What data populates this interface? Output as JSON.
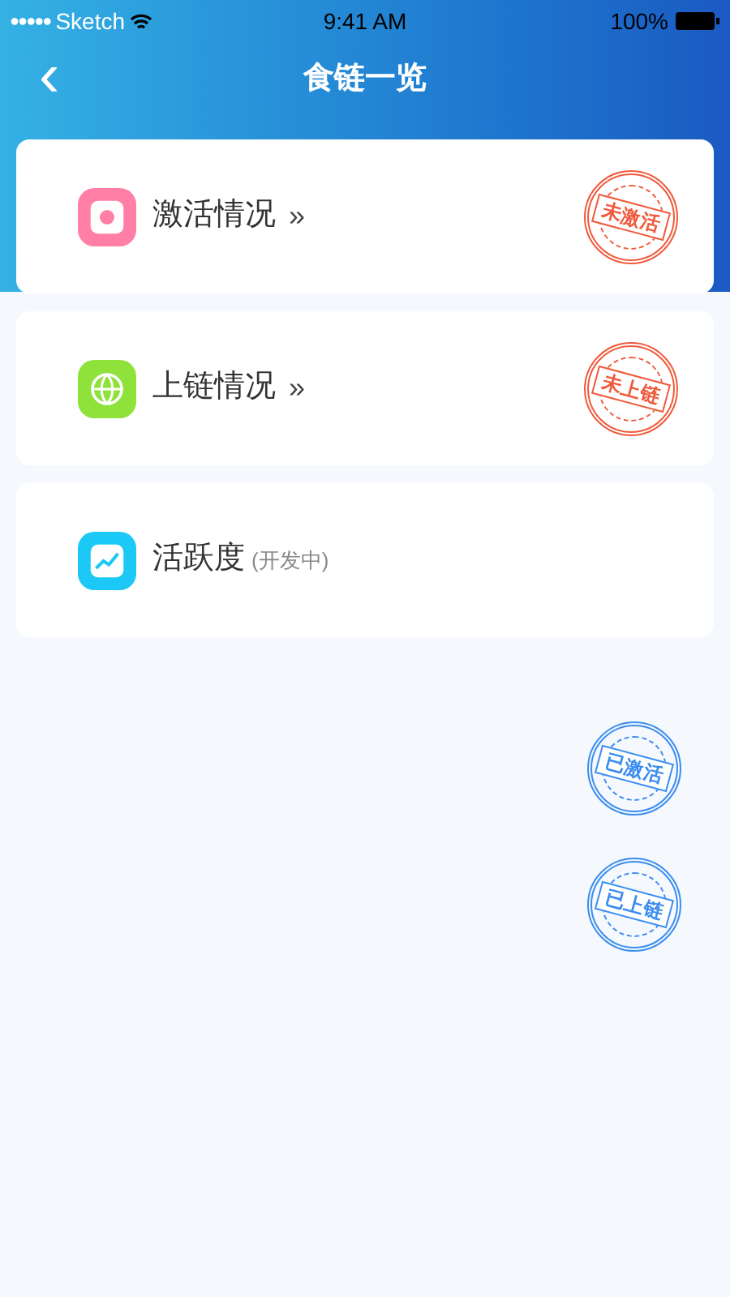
{
  "status_bar": {
    "signal": "●●●●●",
    "carrier": "Sketch",
    "time": "9:41 AM",
    "battery": "100%"
  },
  "nav": {
    "back": "‹",
    "title": "食链一览"
  },
  "cards": [
    {
      "kind": "badge",
      "color": "#ff7fa6",
      "title": "激活情况",
      "arrow": "»",
      "stamp": {
        "text": "未激活",
        "color": "#f05a3c"
      }
    },
    {
      "kind": "globe",
      "color": "#8ee23a",
      "title": "上链情况",
      "arrow": "»",
      "stamp": {
        "text": "未上链",
        "color": "#f05a3c"
      }
    },
    {
      "kind": "chart",
      "color": "#1cc8f5",
      "title": "活跃度",
      "note": "(开发中)"
    }
  ],
  "loose_stamps": [
    {
      "text": "已激活",
      "color": "#3b8df0"
    },
    {
      "text": "已上链",
      "color": "#3b8df0"
    }
  ]
}
